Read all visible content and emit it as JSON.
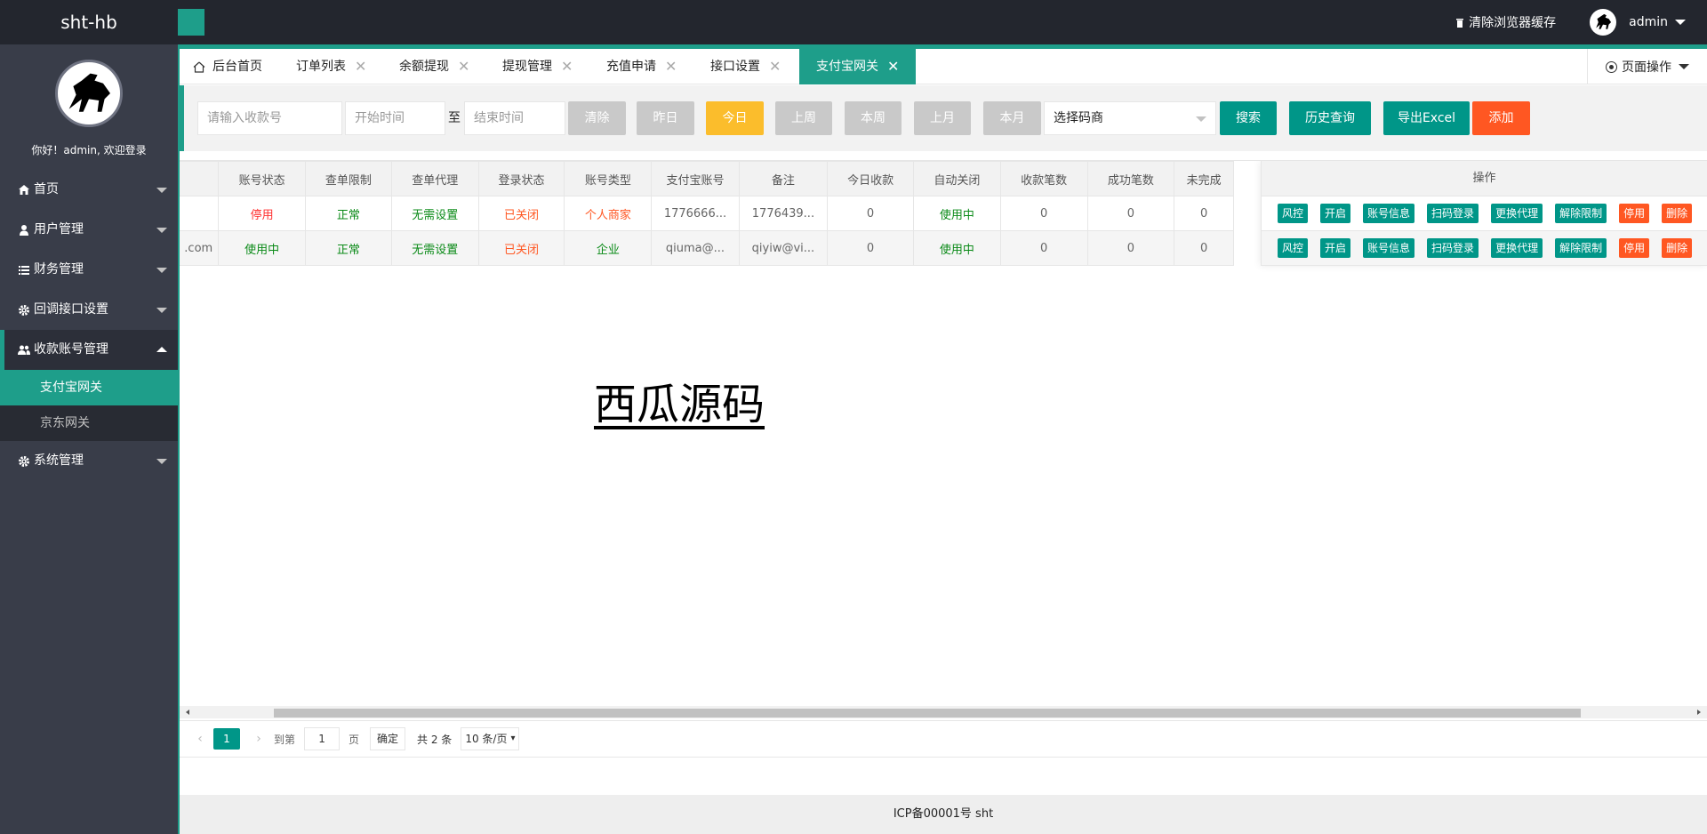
{
  "header": {
    "logo": "sht-hb",
    "clear_cache": "清除浏览器缓存",
    "username": "admin"
  },
  "sidebar": {
    "welcome": "你好！admin, 欢迎登录",
    "menu": [
      {
        "label": "首页"
      },
      {
        "label": "用户管理"
      },
      {
        "label": "财务管理"
      },
      {
        "label": "回调接口设置"
      },
      {
        "label": "收款账号管理"
      },
      {
        "label": "系统管理"
      }
    ],
    "submenu": [
      {
        "label": "支付宝网关"
      },
      {
        "label": "京东网关"
      }
    ]
  },
  "tabs": [
    {
      "label": "后台首页"
    },
    {
      "label": "订单列表"
    },
    {
      "label": "余额提现"
    },
    {
      "label": "提现管理"
    },
    {
      "label": "充值申请"
    },
    {
      "label": "接口设置"
    },
    {
      "label": "支付宝网关"
    }
  ],
  "page_ops": "页面操作",
  "toolbar": {
    "account_placeholder": "请输入收款号",
    "start_placeholder": "开始时间",
    "to_label": "至",
    "end_placeholder": "结束时间",
    "clear": "清除",
    "yesterday": "昨日",
    "today": "今日",
    "last_week": "上周",
    "this_week": "本周",
    "last_month": "上月",
    "this_month": "本月",
    "merchant_select": "选择码商",
    "search": "搜索",
    "history": "历史查询",
    "export": "导出Excel",
    "add": "添加"
  },
  "table": {
    "headers": [
      "账号状态",
      "查单限制",
      "查单代理",
      "登录状态",
      "账号类型",
      "支付宝账号",
      "备注",
      "今日收款",
      "自动关闭",
      "收款笔数",
      "成功笔数",
      "未完成"
    ],
    "rows": [
      [
        "",
        "停用",
        "正常",
        "无需设置",
        "已关闭",
        "个人商家",
        "1776666...",
        "1776439...",
        "0",
        "使用中",
        "0",
        "0",
        "0"
      ],
      [
        ".com",
        "使用中",
        "正常",
        "无需设置",
        "已关闭",
        "企业",
        "qiuma@...",
        "qiyiw@vi...",
        "0",
        "使用中",
        "0",
        "0",
        "0"
      ]
    ],
    "ops_header": "操作",
    "ops_buttons": [
      {
        "label": "风控",
        "color": "#009688"
      },
      {
        "label": "开启",
        "color": "#009688"
      },
      {
        "label": "账号信息",
        "color": "#009688"
      },
      {
        "label": "扫码登录",
        "color": "#009688"
      },
      {
        "label": "更换代理",
        "color": "#009688"
      },
      {
        "label": "解除限制",
        "color": "#009688"
      },
      {
        "label": "停用",
        "color": "#ff5722"
      },
      {
        "label": "删除",
        "color": "#ff5722"
      }
    ]
  },
  "watermark": "西瓜源码",
  "pager": {
    "current": "1",
    "goto_label": "到第",
    "goto_value": "1",
    "page_label": "页",
    "confirm": "确定",
    "total": "共 2 条",
    "page_size": "10 条/页"
  },
  "footer": "ICP备00001号 sht"
}
